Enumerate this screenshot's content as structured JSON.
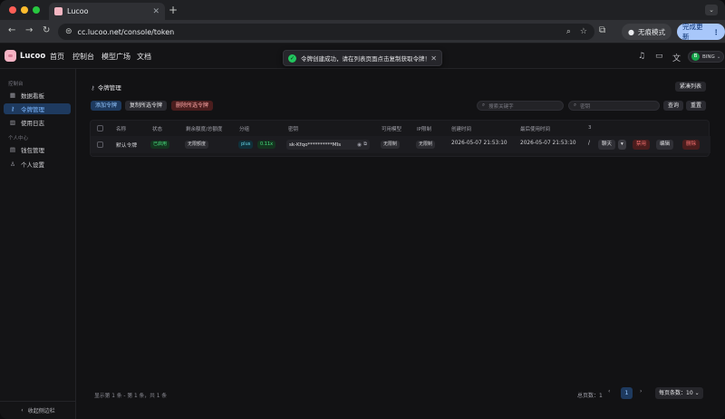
{
  "browser": {
    "tab_title": "Lucoo",
    "url": "cc.lucoo.net/console/token",
    "incognito_label": "无痕模式",
    "update_label": "完成更新"
  },
  "header": {
    "brand": "Lucoo",
    "nav": [
      "首页",
      "控制台",
      "模型广场",
      "文档"
    ],
    "toast": "令牌创建成功，请在列表页面点击复制获取令牌！",
    "user_initial": "B",
    "user_name": "BING"
  },
  "sidebar": {
    "groups": [
      {
        "label": "控制台",
        "items": [
          {
            "label": "数据看板"
          },
          {
            "label": "令牌管理"
          },
          {
            "label": "使用日志"
          }
        ]
      },
      {
        "label": "个人中心",
        "items": [
          {
            "label": "钱包管理"
          },
          {
            "label": "个人设置"
          }
        ]
      }
    ],
    "collapse_label": "收起侧边栏"
  },
  "main": {
    "title": "令牌管理",
    "compact_label": "紧凑列表",
    "actions": {
      "add": "添加令牌",
      "copy_selected": "复制所选令牌",
      "delete_selected": "删除所选令牌"
    },
    "search": {
      "keyword_placeholder": "搜索关键字",
      "key_placeholder": "密钥",
      "query_label": "查询",
      "reset_label": "重置"
    },
    "table": {
      "headers": [
        "名称",
        "状态",
        "剩余额度/总额度",
        "分组",
        "密钥",
        "可用模型",
        "IP限制",
        "创建时间",
        "最后使用时间",
        "3"
      ],
      "rows": [
        {
          "name": "默认令牌",
          "status": "已启用",
          "quota": "无限额度",
          "group": "plus",
          "ratio": "0.11x",
          "key": "sk-Kfqo**********MIs",
          "models": "无限制",
          "ip": "无限制",
          "created": "2026-05-07 21:53:10",
          "last_used": "2026-05-07 21:53:10",
          "extra": "/",
          "chat_label": "聊天",
          "disable_label": "禁用",
          "edit_label": "编辑",
          "delete_label": "删除"
        }
      ]
    },
    "footer": {
      "summary": "显示第 1 条 - 第 1 条，共 1 条",
      "total_pages": "总页数：1",
      "current_page": "1",
      "page_size": "每页条数：10"
    }
  }
}
